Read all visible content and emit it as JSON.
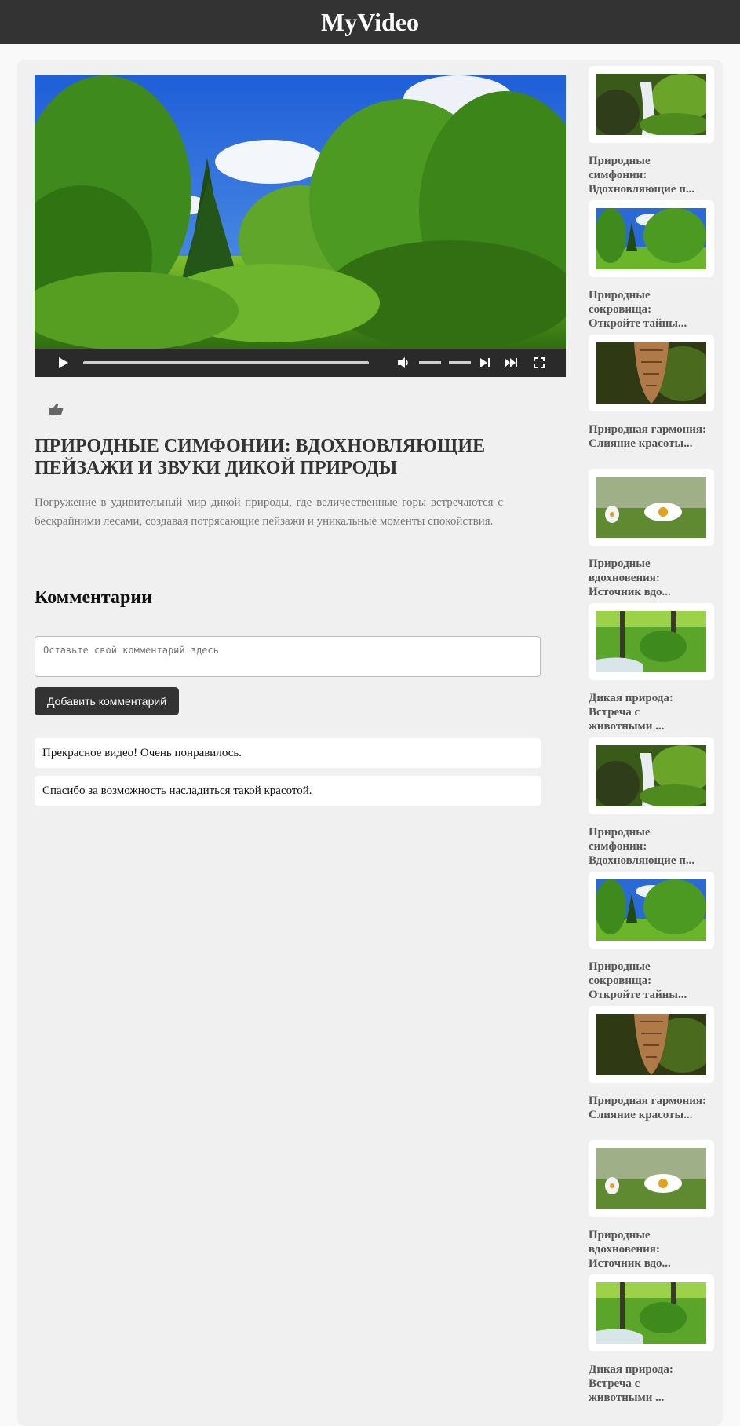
{
  "header": {
    "logo": "MyVideo"
  },
  "player": {
    "progress_fraction": 0.0,
    "volume_fraction": 1.0,
    "play_icon": "play-icon",
    "mute_icon": "volume-icon",
    "next_icon": "next-icon",
    "skip_icon": "skip-forward-icon",
    "fullscreen_icon": "fullscreen-icon"
  },
  "actions": {
    "like_icon": "thumbs-up-icon"
  },
  "video": {
    "title": "ПРИРОДНЫЕ СИМФОНИИ: ВДОХНОВЛЯЮЩИЕ ПЕЙЗАЖИ И ЗВУКИ ДИКОЙ ПРИРОДЫ",
    "description": "Погружение в удивительный мир дикой природы, где величественные горы встречаются с бескрайними лесами, создавая потрясающие пейзажи и уникальные моменты спокойствия."
  },
  "comments": {
    "heading": "Комментарии",
    "placeholder": "Оставьте свой комментарий здесь",
    "add_button": "Добавить комментарий",
    "items": [
      "Прекрасное видео! Очень понравилось.",
      "Спасибо за возможность насладиться такой красотой."
    ]
  },
  "sidebar": {
    "items": [
      {
        "title": "Природные симфонии: Вдохновляющие п...",
        "thumb": "waterfall"
      },
      {
        "title": "Природные сокровища: Откройте тайны...",
        "thumb": "forest"
      },
      {
        "title": "Природная гармония: Слияние красоты...",
        "thumb": "pinecone"
      },
      {
        "title": "Природные вдохновения: Источник вдо...",
        "thumb": "daisy"
      },
      {
        "title": "Дикая природа: Встреча с животными ...",
        "thumb": "stream"
      },
      {
        "title": "Природные симфонии: Вдохновляющие п...",
        "thumb": "waterfall"
      },
      {
        "title": "Природные сокровища: Откройте тайны...",
        "thumb": "forest"
      },
      {
        "title": "Природная гармония: Слияние красоты...",
        "thumb": "pinecone"
      },
      {
        "title": "Природные вдохновения: Источник вдо...",
        "thumb": "daisy"
      },
      {
        "title": "Дикая природа: Встреча с животными ...",
        "thumb": "stream"
      }
    ]
  }
}
